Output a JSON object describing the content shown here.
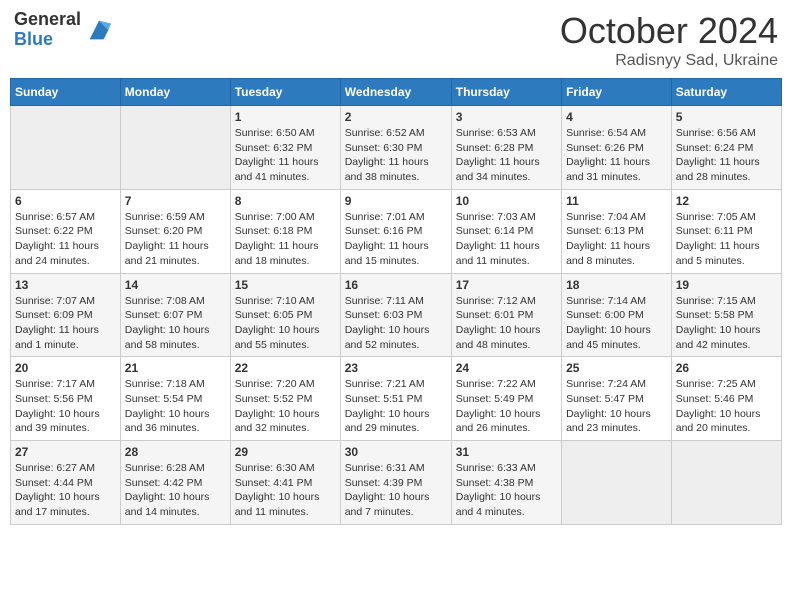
{
  "header": {
    "logo_general": "General",
    "logo_blue": "Blue",
    "month": "October 2024",
    "location": "Radisnyy Sad, Ukraine"
  },
  "days_of_week": [
    "Sunday",
    "Monday",
    "Tuesday",
    "Wednesday",
    "Thursday",
    "Friday",
    "Saturday"
  ],
  "weeks": [
    [
      {
        "day": "",
        "info": ""
      },
      {
        "day": "",
        "info": ""
      },
      {
        "day": "1",
        "info": "Sunrise: 6:50 AM\nSunset: 6:32 PM\nDaylight: 11 hours and 41 minutes."
      },
      {
        "day": "2",
        "info": "Sunrise: 6:52 AM\nSunset: 6:30 PM\nDaylight: 11 hours and 38 minutes."
      },
      {
        "day": "3",
        "info": "Sunrise: 6:53 AM\nSunset: 6:28 PM\nDaylight: 11 hours and 34 minutes."
      },
      {
        "day": "4",
        "info": "Sunrise: 6:54 AM\nSunset: 6:26 PM\nDaylight: 11 hours and 31 minutes."
      },
      {
        "day": "5",
        "info": "Sunrise: 6:56 AM\nSunset: 6:24 PM\nDaylight: 11 hours and 28 minutes."
      }
    ],
    [
      {
        "day": "6",
        "info": "Sunrise: 6:57 AM\nSunset: 6:22 PM\nDaylight: 11 hours and 24 minutes."
      },
      {
        "day": "7",
        "info": "Sunrise: 6:59 AM\nSunset: 6:20 PM\nDaylight: 11 hours and 21 minutes."
      },
      {
        "day": "8",
        "info": "Sunrise: 7:00 AM\nSunset: 6:18 PM\nDaylight: 11 hours and 18 minutes."
      },
      {
        "day": "9",
        "info": "Sunrise: 7:01 AM\nSunset: 6:16 PM\nDaylight: 11 hours and 15 minutes."
      },
      {
        "day": "10",
        "info": "Sunrise: 7:03 AM\nSunset: 6:14 PM\nDaylight: 11 hours and 11 minutes."
      },
      {
        "day": "11",
        "info": "Sunrise: 7:04 AM\nSunset: 6:13 PM\nDaylight: 11 hours and 8 minutes."
      },
      {
        "day": "12",
        "info": "Sunrise: 7:05 AM\nSunset: 6:11 PM\nDaylight: 11 hours and 5 minutes."
      }
    ],
    [
      {
        "day": "13",
        "info": "Sunrise: 7:07 AM\nSunset: 6:09 PM\nDaylight: 11 hours and 1 minute."
      },
      {
        "day": "14",
        "info": "Sunrise: 7:08 AM\nSunset: 6:07 PM\nDaylight: 10 hours and 58 minutes."
      },
      {
        "day": "15",
        "info": "Sunrise: 7:10 AM\nSunset: 6:05 PM\nDaylight: 10 hours and 55 minutes."
      },
      {
        "day": "16",
        "info": "Sunrise: 7:11 AM\nSunset: 6:03 PM\nDaylight: 10 hours and 52 minutes."
      },
      {
        "day": "17",
        "info": "Sunrise: 7:12 AM\nSunset: 6:01 PM\nDaylight: 10 hours and 48 minutes."
      },
      {
        "day": "18",
        "info": "Sunrise: 7:14 AM\nSunset: 6:00 PM\nDaylight: 10 hours and 45 minutes."
      },
      {
        "day": "19",
        "info": "Sunrise: 7:15 AM\nSunset: 5:58 PM\nDaylight: 10 hours and 42 minutes."
      }
    ],
    [
      {
        "day": "20",
        "info": "Sunrise: 7:17 AM\nSunset: 5:56 PM\nDaylight: 10 hours and 39 minutes."
      },
      {
        "day": "21",
        "info": "Sunrise: 7:18 AM\nSunset: 5:54 PM\nDaylight: 10 hours and 36 minutes."
      },
      {
        "day": "22",
        "info": "Sunrise: 7:20 AM\nSunset: 5:52 PM\nDaylight: 10 hours and 32 minutes."
      },
      {
        "day": "23",
        "info": "Sunrise: 7:21 AM\nSunset: 5:51 PM\nDaylight: 10 hours and 29 minutes."
      },
      {
        "day": "24",
        "info": "Sunrise: 7:22 AM\nSunset: 5:49 PM\nDaylight: 10 hours and 26 minutes."
      },
      {
        "day": "25",
        "info": "Sunrise: 7:24 AM\nSunset: 5:47 PM\nDaylight: 10 hours and 23 minutes."
      },
      {
        "day": "26",
        "info": "Sunrise: 7:25 AM\nSunset: 5:46 PM\nDaylight: 10 hours and 20 minutes."
      }
    ],
    [
      {
        "day": "27",
        "info": "Sunrise: 6:27 AM\nSunset: 4:44 PM\nDaylight: 10 hours and 17 minutes."
      },
      {
        "day": "28",
        "info": "Sunrise: 6:28 AM\nSunset: 4:42 PM\nDaylight: 10 hours and 14 minutes."
      },
      {
        "day": "29",
        "info": "Sunrise: 6:30 AM\nSunset: 4:41 PM\nDaylight: 10 hours and 11 minutes."
      },
      {
        "day": "30",
        "info": "Sunrise: 6:31 AM\nSunset: 4:39 PM\nDaylight: 10 hours and 7 minutes."
      },
      {
        "day": "31",
        "info": "Sunrise: 6:33 AM\nSunset: 4:38 PM\nDaylight: 10 hours and 4 minutes."
      },
      {
        "day": "",
        "info": ""
      },
      {
        "day": "",
        "info": ""
      }
    ]
  ]
}
